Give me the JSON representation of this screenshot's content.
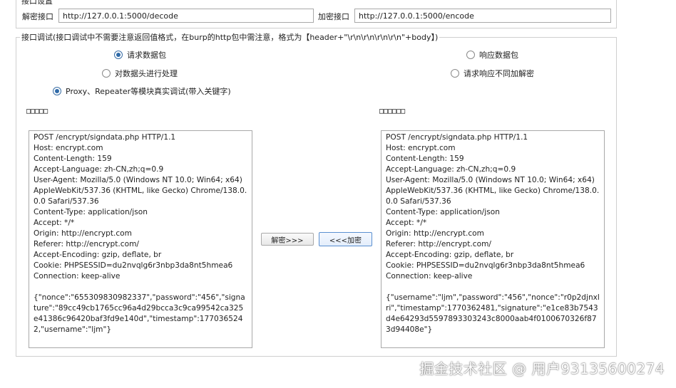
{
  "top_group": {
    "title_fragment": "接口设置",
    "decode_label": "解密接口",
    "decode_url": "http://127.0.0.1:5000/decode",
    "encode_label": "加密接口",
    "encode_url": "http://127.0.0.1:5000/encode"
  },
  "debug_group": {
    "legend": "接口调试(接口调试中不需要注意返回值格式，在burp的http包中需注意，格式为【header+\"\\r\\n\\r\\n\\r\\n\\r\\n\"+body】)",
    "radios": {
      "request_packet": {
        "label": "请求数据包",
        "checked": true
      },
      "response_packet": {
        "label": "响应数据包",
        "checked": false
      },
      "header_process": {
        "label": "对数据头进行处理",
        "checked": false
      },
      "no_encrypt_response": {
        "label": "请求响应不同加解密",
        "checked": false
      },
      "proxy_repeater": {
        "label": "Proxy、Repeater等模块真实调试(带入关键字)",
        "checked": true
      }
    },
    "left_heading": "□□□□□",
    "right_heading": "□□□□□□",
    "left_text": "POST /encrypt/signdata.php HTTP/1.1\nHost: encrypt.com\nContent-Length: 159\nAccept-Language: zh-CN,zh;q=0.9\nUser-Agent: Mozilla/5.0 (Windows NT 10.0; Win64; x64) AppleWebKit/537.36 (KHTML, like Gecko) Chrome/138.0.0.0 Safari/537.36\nContent-Type: application/json\nAccept: */*\nOrigin: http://encrypt.com\nReferer: http://encrypt.com/\nAccept-Encoding: gzip, deflate, br\nCookie: PHPSESSID=du2nvqlg6r3nbp3da8nt5hmea6\nConnection: keep-alive\n\n{\"nonce\":\"655309830982337\",\"password\":\"456\",\"signature\":\"89cc49cb1765cc96a4d29bcca3c9ca99542ca325e41386c96420baf3fd9e140d\",\"timestamp\":1770365242,\"username\":\"ljm\"}",
    "right_text": "POST /encrypt/signdata.php HTTP/1.1\nHost: encrypt.com\nContent-Length: 159\nAccept-Language: zh-CN,zh;q=0.9\nUser-Agent: Mozilla/5.0 (Windows NT 10.0; Win64; x64) AppleWebKit/537.36 (KHTML, like Gecko) Chrome/138.0.0.0 Safari/537.36\nContent-Type: application/json\nAccept: */*\nOrigin: http://encrypt.com\nReferer: http://encrypt.com/\nAccept-Encoding: gzip, deflate, br\nCookie: PHPSESSID=du2nvqlg6r3nbp3da8nt5hmea6\nConnection: keep-alive\n\n{\"username\":\"ljm\",\"password\":\"456\",\"nonce\":\"r0p2djnxlri\",\"timestamp\":1770362481,\"signature\":\"e1ce83b7543d4e64293d5597893303243c8000aab4f0100670326f873d94408e\"}",
    "decrypt_button": "解密>>>",
    "encrypt_button": "<<<加密"
  },
  "watermark": "掘金技术社区 @ 用户93135600274",
  "colors": {
    "radio_accent": "#2f6aa8",
    "border": "#a9a9a9"
  }
}
